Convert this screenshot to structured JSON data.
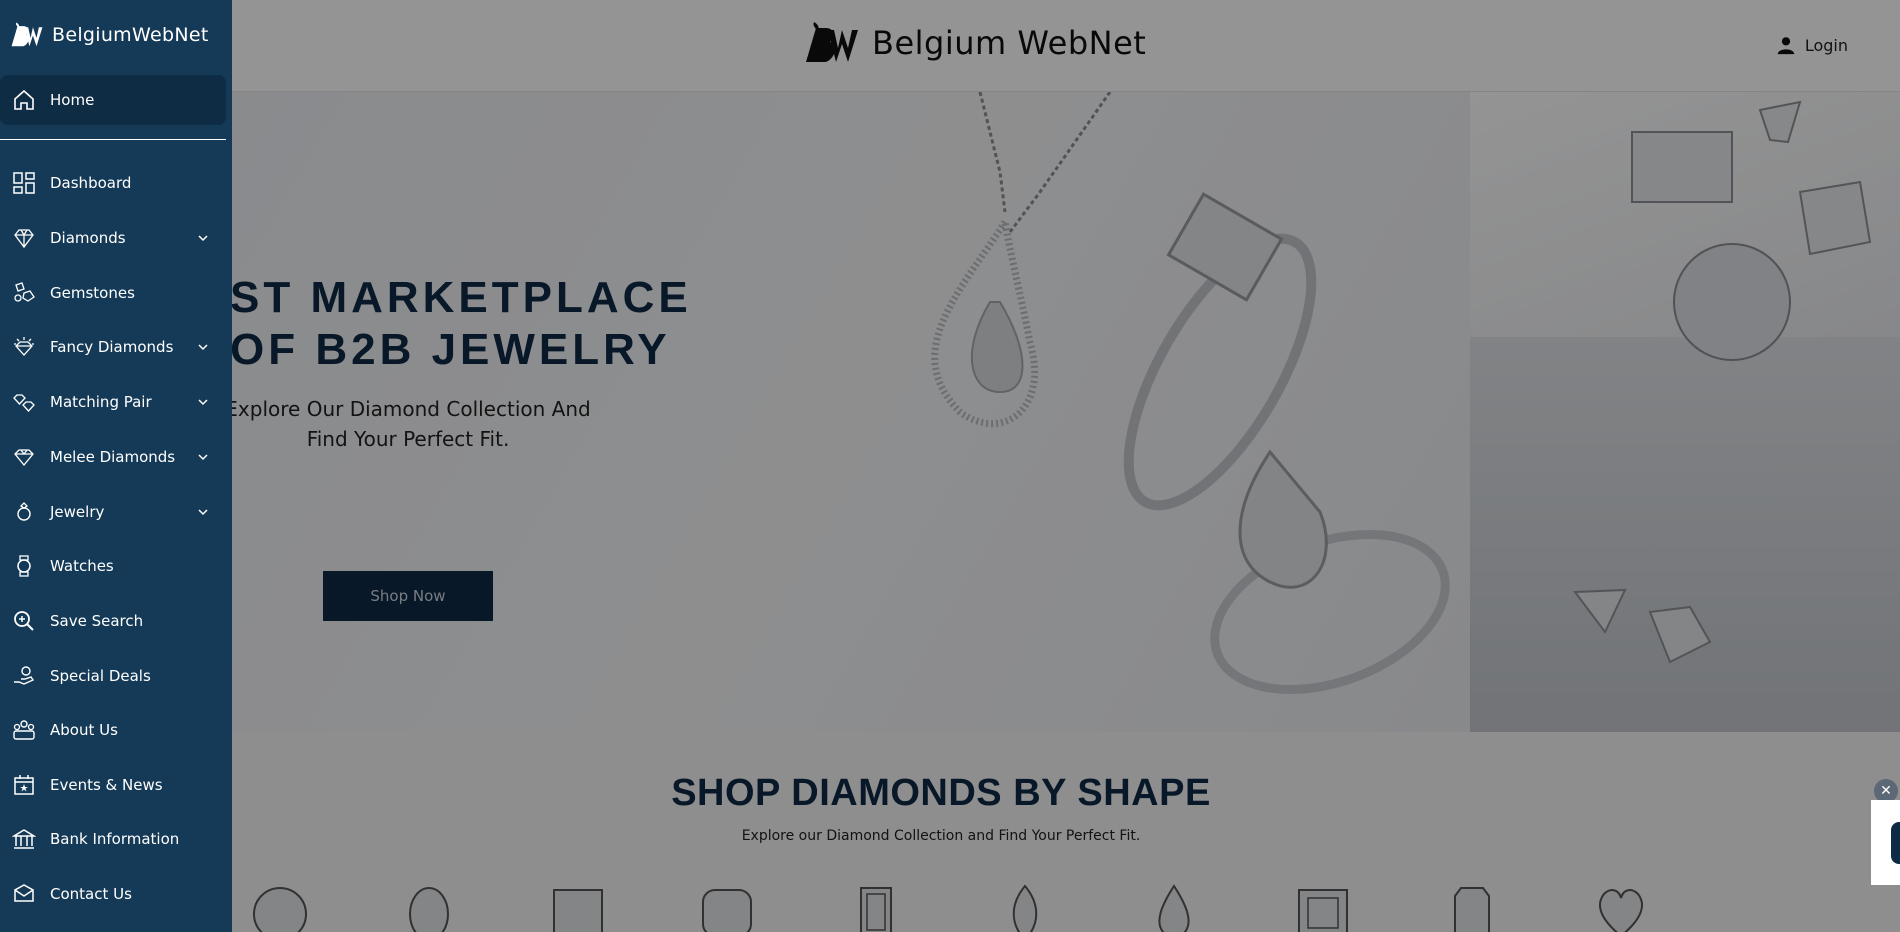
{
  "brand": {
    "name_left": "Belgium",
    "name_right": "WebNet"
  },
  "header": {
    "login_label": "Login"
  },
  "hero": {
    "title_line1": "ST MARKETPLACE",
    "title_line2": "OF B2B JEWELRY",
    "subtitle_line1": "Explore Our Diamond Collection And",
    "subtitle_line2": "Find Your Perfect Fit.",
    "cta_label": "Shop Now"
  },
  "shapes": {
    "title": "SHOP DIAMONDS BY SHAPE",
    "subtitle": "Explore our Diamond Collection and Find Your Perfect Fit.",
    "icons": [
      "round-icon",
      "oval-icon",
      "princess-icon",
      "cushion-icon",
      "emerald-icon",
      "marquise-icon",
      "pear-icon",
      "asscher-icon",
      "radiant-icon",
      "heart-icon"
    ]
  },
  "sidebar": {
    "items": [
      {
        "label": "Home",
        "icon": "home-icon",
        "has_dropdown": false,
        "active": true
      },
      {
        "label": "Dashboard",
        "icon": "dashboard-icon",
        "has_dropdown": false
      },
      {
        "label": "Diamonds",
        "icon": "diamond-icon",
        "has_dropdown": true
      },
      {
        "label": "Gemstones",
        "icon": "gemstone-icon",
        "has_dropdown": false
      },
      {
        "label": "Fancy Diamonds",
        "icon": "fancy-diamond-icon",
        "has_dropdown": true
      },
      {
        "label": "Matching Pair",
        "icon": "matching-pair-icon",
        "has_dropdown": true
      },
      {
        "label": "Melee Diamonds",
        "icon": "melee-diamond-icon",
        "has_dropdown": true
      },
      {
        "label": "Jewelry",
        "icon": "jewelry-icon",
        "has_dropdown": true
      },
      {
        "label": "Watches",
        "icon": "watch-icon",
        "has_dropdown": false
      },
      {
        "label": "Save Search",
        "icon": "save-search-icon",
        "has_dropdown": false
      },
      {
        "label": "Special Deals",
        "icon": "special-deals-icon",
        "has_dropdown": false
      },
      {
        "label": "About Us",
        "icon": "about-us-icon",
        "has_dropdown": false
      },
      {
        "label": "Events & News",
        "icon": "events-icon",
        "has_dropdown": false
      },
      {
        "label": "Bank Information",
        "icon": "bank-icon",
        "has_dropdown": false
      },
      {
        "label": "Contact Us",
        "icon": "contact-icon",
        "has_dropdown": false
      }
    ]
  },
  "colors": {
    "sidebar_bg": "#153a57",
    "sidebar_active": "#0f2c45",
    "brand_navy": "#0e2a45",
    "overlay": "rgba(0,0,0,0.42)"
  }
}
